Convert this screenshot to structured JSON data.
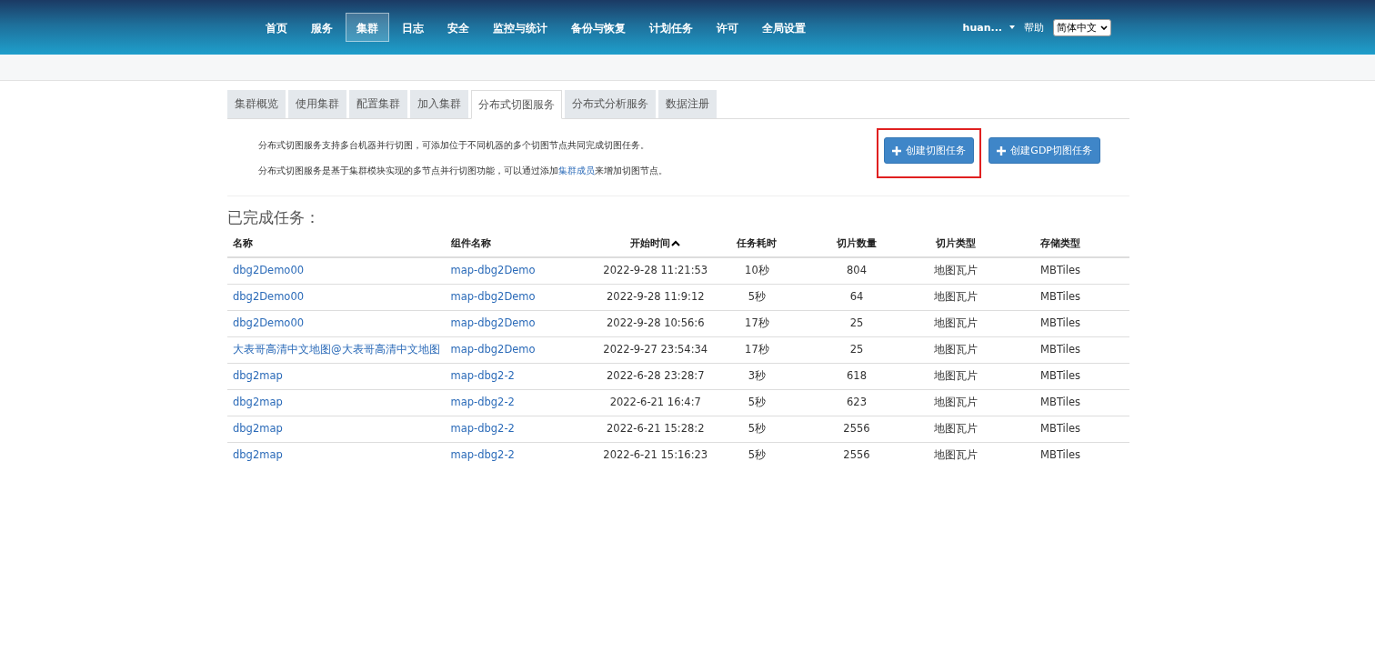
{
  "nav": {
    "items": [
      {
        "label": "首页",
        "selected": false
      },
      {
        "label": "服务",
        "selected": false
      },
      {
        "label": "集群",
        "selected": true
      },
      {
        "label": "日志",
        "selected": false
      },
      {
        "label": "安全",
        "selected": false
      },
      {
        "label": "监控与统计",
        "selected": false
      },
      {
        "label": "备份与恢复",
        "selected": false
      },
      {
        "label": "计划任务",
        "selected": false
      },
      {
        "label": "许可",
        "selected": false
      },
      {
        "label": "全局设置",
        "selected": false
      }
    ],
    "user": "huan...",
    "help": "帮助",
    "language": "简体中文"
  },
  "tabs": [
    {
      "label": "集群概览",
      "selected": false
    },
    {
      "label": "使用集群",
      "selected": false
    },
    {
      "label": "配置集群",
      "selected": false
    },
    {
      "label": "加入集群",
      "selected": false
    },
    {
      "label": "分布式切图服务",
      "selected": true
    },
    {
      "label": "分布式分析服务",
      "selected": false
    },
    {
      "label": "数据注册",
      "selected": false
    }
  ],
  "description": [
    {
      "text": "分布式切图服务支持多台机器并行切图，可添加位于不同机器的多个切图节点共同完成切图任务。"
    },
    {
      "text": "分布式切图服务是基于集群模块实现的多节点并行切图功能，可以通过添加",
      "link": "集群成员",
      "text_after": "来增加切图节点。"
    }
  ],
  "buttons": [
    {
      "label": "创建切图任务",
      "highlighted": true
    },
    {
      "label": "创建GDP切图任务",
      "highlighted": false
    }
  ],
  "table": {
    "title": "已完成任务：",
    "columns": [
      "名称",
      "组件名称",
      "开始时间",
      "任务耗时",
      "切片数量",
      "切片类型",
      "存储类型"
    ],
    "rows": [
      [
        "dbg2Demo00",
        "map-dbg2Demo",
        "2022-9-28 11:21:53",
        "10秒",
        "804",
        "地图瓦片",
        "MBTiles"
      ],
      [
        "dbg2Demo00",
        "map-dbg2Demo",
        "2022-9-28 11:9:12",
        "5秒",
        "64",
        "地图瓦片",
        "MBTiles"
      ],
      [
        "dbg2Demo00",
        "map-dbg2Demo",
        "2022-9-28 10:56:6",
        "17秒",
        "25",
        "地图瓦片",
        "MBTiles"
      ],
      [
        "大表哥高清中文地图@大表哥高清中文地图",
        "map-dbg2Demo",
        "2022-9-27 23:54:34",
        "17秒",
        "25",
        "地图瓦片",
        "MBTiles"
      ],
      [
        "dbg2map",
        "map-dbg2-2",
        "2022-6-28 23:28:7",
        "3秒",
        "618",
        "地图瓦片",
        "MBTiles"
      ],
      [
        "dbg2map",
        "map-dbg2-2",
        "2022-6-21 16:4:7",
        "5秒",
        "623",
        "地图瓦片",
        "MBTiles"
      ],
      [
        "dbg2map",
        "map-dbg2-2",
        "2022-6-21 15:28:2",
        "5秒",
        "2556",
        "地图瓦片",
        "MBTiles"
      ],
      [
        "dbg2map",
        "map-dbg2-2",
        "2022-6-21 15:16:23",
        "5秒",
        "2556",
        "地图瓦片",
        "MBTiles"
      ]
    ]
  }
}
